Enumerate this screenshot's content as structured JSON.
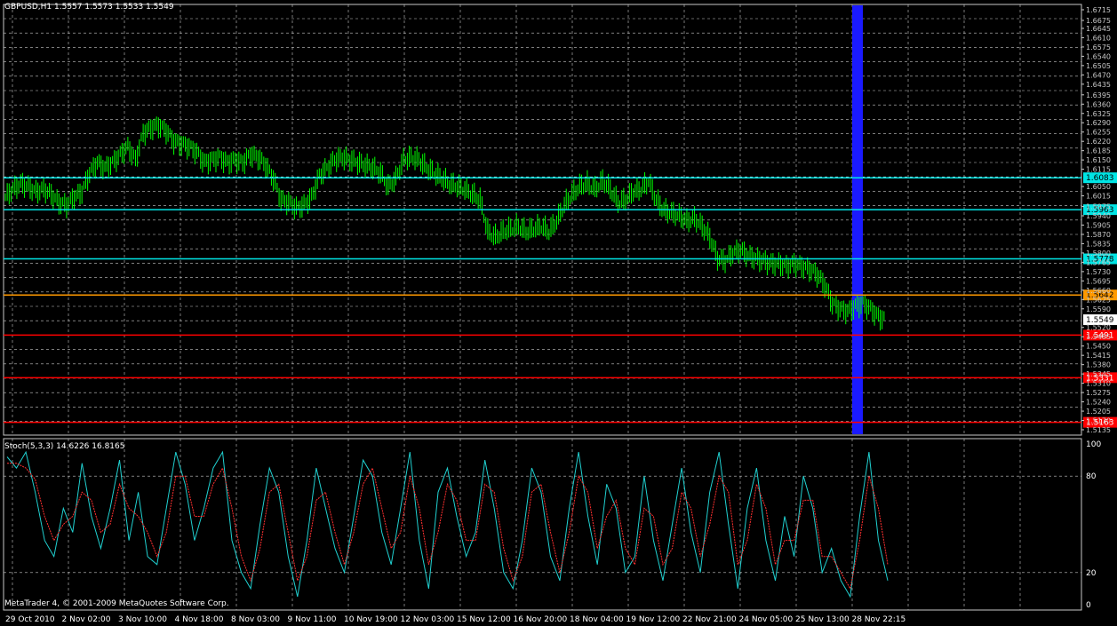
{
  "window": {
    "title": "GBPUSD,H1  1.5557 1.5573 1.5533 1.5549"
  },
  "colors": {
    "background": "#000000",
    "grid": "#c8c8c8",
    "candles": "#00ff00",
    "stoch_main": "#20d0d0",
    "stoch_signal": "#ff3030",
    "selection_bar": "#1a1aff"
  },
  "chart_data": [
    {
      "type": "candlestick",
      "symbol": "GBPUSD",
      "timeframe": "H1",
      "ohlc_last": {
        "open": 1.5557,
        "high": 1.5573,
        "low": 1.5533,
        "close": 1.5549
      },
      "ylim": [
        1.5135,
        1.6715
      ],
      "y_ticks": [
        "1.6715",
        "1.6675",
        "1.6645",
        "1.6610",
        "1.6575",
        "1.6540",
        "1.6505",
        "1.6470",
        "1.6435",
        "1.6395",
        "1.6360",
        "1.6325",
        "1.6290",
        "1.6255",
        "1.6220",
        "1.6185",
        "1.6150",
        "1.6115",
        "1.6050",
        "1.6015",
        "1.5975",
        "1.5940",
        "1.5905",
        "1.5870",
        "1.5835",
        "1.5800",
        "1.5765",
        "1.5730",
        "1.5695",
        "1.5660",
        "1.5625",
        "1.5590",
        "1.5520",
        "1.5485",
        "1.5450",
        "1.5415",
        "1.5380",
        "1.5345",
        "1.5310",
        "1.5275",
        "1.5240",
        "1.5205",
        "1.5170",
        "1.5135"
      ],
      "x_ticks": [
        "29 Oct 2010",
        "2 Nov 02:00",
        "3 Nov 10:00",
        "4 Nov 18:00",
        "8 Nov 03:00",
        "9 Nov 11:00",
        "10 Nov 19:00",
        "12 Nov 03:00",
        "15 Nov 12:00",
        "16 Nov 20:00",
        "18 Nov 04:00",
        "19 Nov 12:00",
        "22 Nov 21:00",
        "24 Nov 05:00",
        "25 Nov 13:00",
        "28 Nov 22:15"
      ],
      "price_path": [
        [
          0,
          1.601
        ],
        [
          5,
          1.604
        ],
        [
          10,
          1.606
        ],
        [
          15,
          1.605
        ],
        [
          20,
          1.603
        ],
        [
          25,
          1.604
        ],
        [
          30,
          1.602
        ],
        [
          35,
          1.599
        ],
        [
          40,
          1.598
        ],
        [
          45,
          1.601
        ],
        [
          50,
          1.603
        ],
        [
          55,
          1.61
        ],
        [
          60,
          1.614
        ],
        [
          65,
          1.612
        ],
        [
          70,
          1.614
        ],
        [
          75,
          1.617
        ],
        [
          80,
          1.62
        ],
        [
          85,
          1.615
        ],
        [
          90,
          1.625
        ],
        [
          95,
          1.627
        ],
        [
          100,
          1.628
        ],
        [
          105,
          1.626
        ],
        [
          110,
          1.622
        ],
        [
          115,
          1.621
        ],
        [
          120,
          1.62
        ],
        [
          125,
          1.618
        ],
        [
          130,
          1.614
        ],
        [
          135,
          1.615
        ],
        [
          140,
          1.616
        ],
        [
          145,
          1.614
        ],
        [
          150,
          1.615
        ],
        [
          155,
          1.614
        ],
        [
          160,
          1.617
        ],
        [
          165,
          1.616
        ],
        [
          170,
          1.613
        ],
        [
          175,
          1.608
        ],
        [
          180,
          1.6
        ],
        [
          185,
          1.599
        ],
        [
          190,
          1.597
        ],
        [
          195,
          1.598
        ],
        [
          200,
          1.601
        ],
        [
          205,
          1.609
        ],
        [
          210,
          1.612
        ],
        [
          215,
          1.615
        ],
        [
          220,
          1.616
        ],
        [
          225,
          1.615
        ],
        [
          230,
          1.614
        ],
        [
          235,
          1.613
        ],
        [
          240,
          1.612
        ],
        [
          245,
          1.61
        ],
        [
          250,
          1.605
        ],
        [
          255,
          1.608
        ],
        [
          260,
          1.615
        ],
        [
          265,
          1.616
        ],
        [
          270,
          1.615
        ],
        [
          275,
          1.612
        ],
        [
          280,
          1.61
        ],
        [
          285,
          1.608
        ],
        [
          290,
          1.606
        ],
        [
          295,
          1.605
        ],
        [
          300,
          1.604
        ],
        [
          305,
          1.602
        ],
        [
          310,
          1.6
        ],
        [
          315,
          1.588
        ],
        [
          320,
          1.586
        ],
        [
          325,
          1.588
        ],
        [
          330,
          1.589
        ],
        [
          335,
          1.59
        ],
        [
          340,
          1.588
        ],
        [
          345,
          1.589
        ],
        [
          350,
          1.59
        ],
        [
          355,
          1.588
        ],
        [
          360,
          1.592
        ],
        [
          365,
          1.598
        ],
        [
          370,
          1.602
        ],
        [
          375,
          1.605
        ],
        [
          380,
          1.606
        ],
        [
          385,
          1.604
        ],
        [
          390,
          1.607
        ],
        [
          395,
          1.604
        ],
        [
          400,
          1.599
        ],
        [
          405,
          1.6
        ],
        [
          410,
          1.603
        ],
        [
          415,
          1.604
        ],
        [
          420,
          1.607
        ],
        [
          425,
          1.6
        ],
        [
          430,
          1.596
        ],
        [
          435,
          1.595
        ],
        [
          440,
          1.594
        ],
        [
          445,
          1.592
        ],
        [
          450,
          1.593
        ],
        [
          455,
          1.59
        ],
        [
          460,
          1.586
        ],
        [
          465,
          1.578
        ],
        [
          470,
          1.577
        ],
        [
          475,
          1.58
        ],
        [
          480,
          1.581
        ],
        [
          485,
          1.579
        ],
        [
          490,
          1.578
        ],
        [
          495,
          1.577
        ],
        [
          500,
          1.576
        ],
        [
          505,
          1.576
        ],
        [
          510,
          1.575
        ],
        [
          515,
          1.576
        ],
        [
          520,
          1.575
        ],
        [
          525,
          1.574
        ],
        [
          530,
          1.572
        ],
        [
          535,
          1.568
        ],
        [
          540,
          1.561
        ],
        [
          545,
          1.559
        ],
        [
          550,
          1.558
        ],
        [
          555,
          1.56
        ],
        [
          560,
          1.561
        ],
        [
          565,
          1.559
        ],
        [
          570,
          1.556
        ],
        [
          575,
          1.5549
        ]
      ],
      "horizontal_levels": [
        {
          "price": "1.6083",
          "color": "#00e5e5"
        },
        {
          "price": "1.5963",
          "color": "#00e5e5"
        },
        {
          "price": "1.5778",
          "color": "#00e5e5"
        },
        {
          "price": "1.5642",
          "color": "#ff9900"
        },
        {
          "price": "1.5549",
          "color": "#ffffff"
        },
        {
          "price": "1.5491",
          "color": "#ff0000"
        },
        {
          "price": "1.5331",
          "color": "#ff0000"
        },
        {
          "price": "1.5163",
          "color": "#ff0000"
        }
      ]
    },
    {
      "type": "line",
      "name": "Stoch(5,3,3) 14.6226 16.8165",
      "ylim": [
        0,
        100
      ],
      "y_ticks": [
        "100",
        "80",
        "20",
        "0"
      ],
      "series": [
        {
          "name": "main",
          "values": [
            92,
            85,
            95,
            70,
            40,
            30,
            60,
            45,
            88,
            55,
            35,
            60,
            90,
            40,
            70,
            30,
            25,
            60,
            95,
            75,
            40,
            60,
            85,
            95,
            40,
            20,
            10,
            50,
            85,
            70,
            30,
            5,
            40,
            85,
            60,
            35,
            20,
            55,
            90,
            80,
            45,
            25,
            60,
            95,
            40,
            10,
            70,
            85,
            55,
            30,
            45,
            90,
            60,
            20,
            10,
            40,
            85,
            70,
            30,
            15,
            60,
            95,
            55,
            25,
            75,
            60,
            20,
            30,
            80,
            40,
            15,
            50,
            85,
            45,
            20,
            70,
            95,
            50,
            10,
            60,
            85,
            40,
            15,
            55,
            30,
            80,
            60,
            20,
            35,
            15,
            5,
            55,
            95,
            40,
            15
          ]
        },
        {
          "name": "signal",
          "values": [
            88,
            88,
            85,
            78,
            55,
            40,
            50,
            55,
            70,
            65,
            45,
            50,
            75,
            60,
            55,
            45,
            30,
            45,
            80,
            80,
            55,
            55,
            75,
            85,
            60,
            30,
            15,
            35,
            70,
            75,
            45,
            15,
            30,
            65,
            70,
            45,
            25,
            45,
            75,
            85,
            60,
            35,
            45,
            80,
            60,
            25,
            45,
            75,
            65,
            40,
            40,
            75,
            70,
            35,
            15,
            30,
            70,
            75,
            45,
            20,
            45,
            80,
            70,
            35,
            55,
            65,
            35,
            25,
            60,
            55,
            25,
            35,
            70,
            60,
            30,
            50,
            80,
            70,
            25,
            40,
            75,
            60,
            25,
            40,
            40,
            65,
            65,
            30,
            30,
            20,
            10,
            40,
            80,
            60,
            25
          ]
        }
      ]
    }
  ],
  "stoch": {
    "title": "Stoch(5,3,3) 14.6226 16.8165"
  },
  "footer": {
    "copyright": "MetaTrader 4, © 2001-2009 MetaQuotes Software Corp."
  }
}
